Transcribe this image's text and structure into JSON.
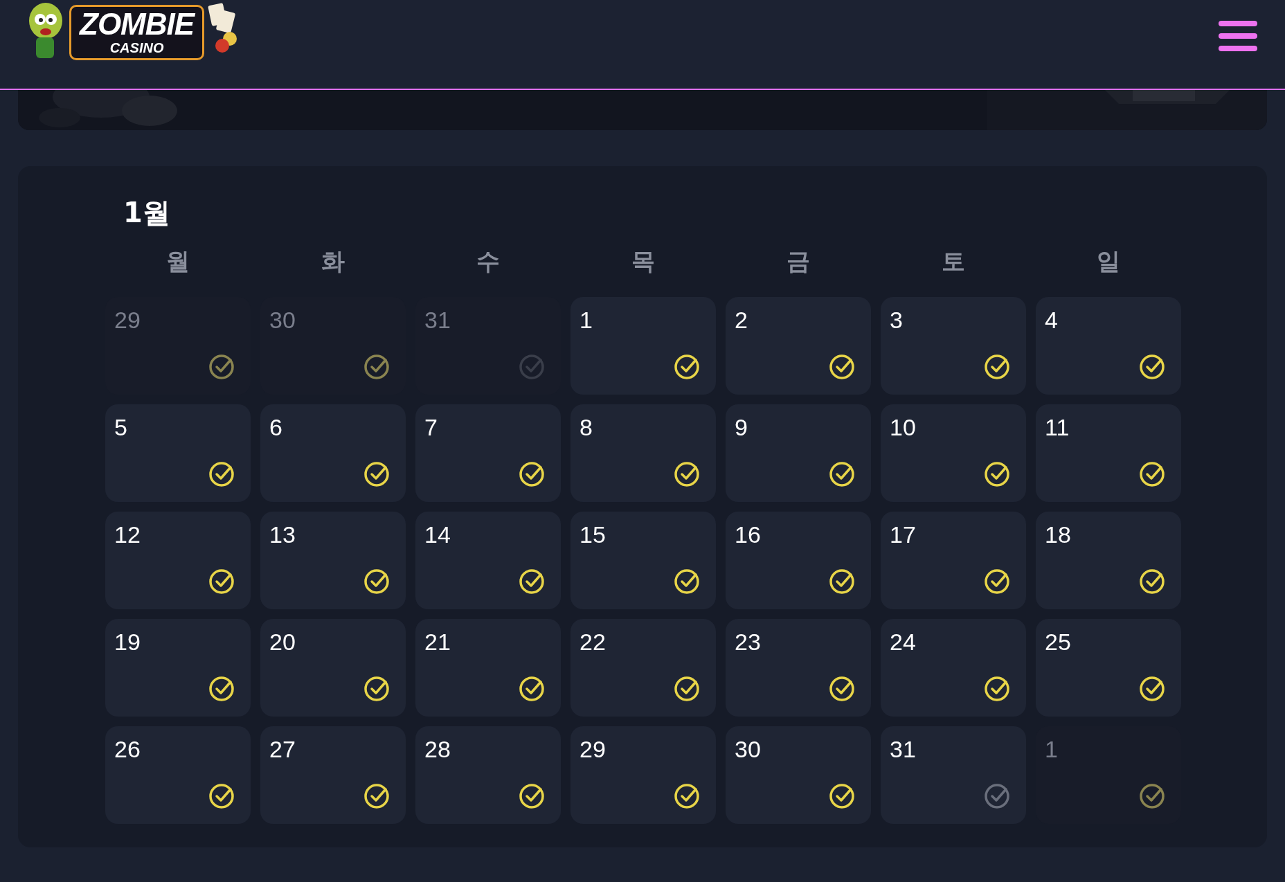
{
  "header": {
    "logo": {
      "line1": "ZOMBIE",
      "line2": "CASINO"
    }
  },
  "calendar": {
    "month": "1월",
    "weekdays": [
      "월",
      "화",
      "수",
      "목",
      "금",
      "토",
      "일"
    ],
    "days": [
      {
        "label": "29",
        "outside": true,
        "checked": true
      },
      {
        "label": "30",
        "outside": true,
        "checked": true
      },
      {
        "label": "31",
        "outside": true,
        "checked": false
      },
      {
        "label": "1",
        "outside": false,
        "checked": true
      },
      {
        "label": "2",
        "outside": false,
        "checked": true
      },
      {
        "label": "3",
        "outside": false,
        "checked": true
      },
      {
        "label": "4",
        "outside": false,
        "checked": true
      },
      {
        "label": "5",
        "outside": false,
        "checked": true
      },
      {
        "label": "6",
        "outside": false,
        "checked": true
      },
      {
        "label": "7",
        "outside": false,
        "checked": true
      },
      {
        "label": "8",
        "outside": false,
        "checked": true
      },
      {
        "label": "9",
        "outside": false,
        "checked": true
      },
      {
        "label": "10",
        "outside": false,
        "checked": true
      },
      {
        "label": "11",
        "outside": false,
        "checked": true
      },
      {
        "label": "12",
        "outside": false,
        "checked": true
      },
      {
        "label": "13",
        "outside": false,
        "checked": true
      },
      {
        "label": "14",
        "outside": false,
        "checked": true
      },
      {
        "label": "15",
        "outside": false,
        "checked": true
      },
      {
        "label": "16",
        "outside": false,
        "checked": true
      },
      {
        "label": "17",
        "outside": false,
        "checked": true
      },
      {
        "label": "18",
        "outside": false,
        "checked": true
      },
      {
        "label": "19",
        "outside": false,
        "checked": true
      },
      {
        "label": "20",
        "outside": false,
        "checked": true
      },
      {
        "label": "21",
        "outside": false,
        "checked": true
      },
      {
        "label": "22",
        "outside": false,
        "checked": true
      },
      {
        "label": "23",
        "outside": false,
        "checked": true
      },
      {
        "label": "24",
        "outside": false,
        "checked": true
      },
      {
        "label": "25",
        "outside": false,
        "checked": true
      },
      {
        "label": "26",
        "outside": false,
        "checked": true
      },
      {
        "label": "27",
        "outside": false,
        "checked": true
      },
      {
        "label": "28",
        "outside": false,
        "checked": true
      },
      {
        "label": "29",
        "outside": false,
        "checked": true
      },
      {
        "label": "30",
        "outside": false,
        "checked": true
      },
      {
        "label": "31",
        "outside": false,
        "checked": false
      },
      {
        "label": "1",
        "outside": true,
        "checked": true
      }
    ]
  }
}
